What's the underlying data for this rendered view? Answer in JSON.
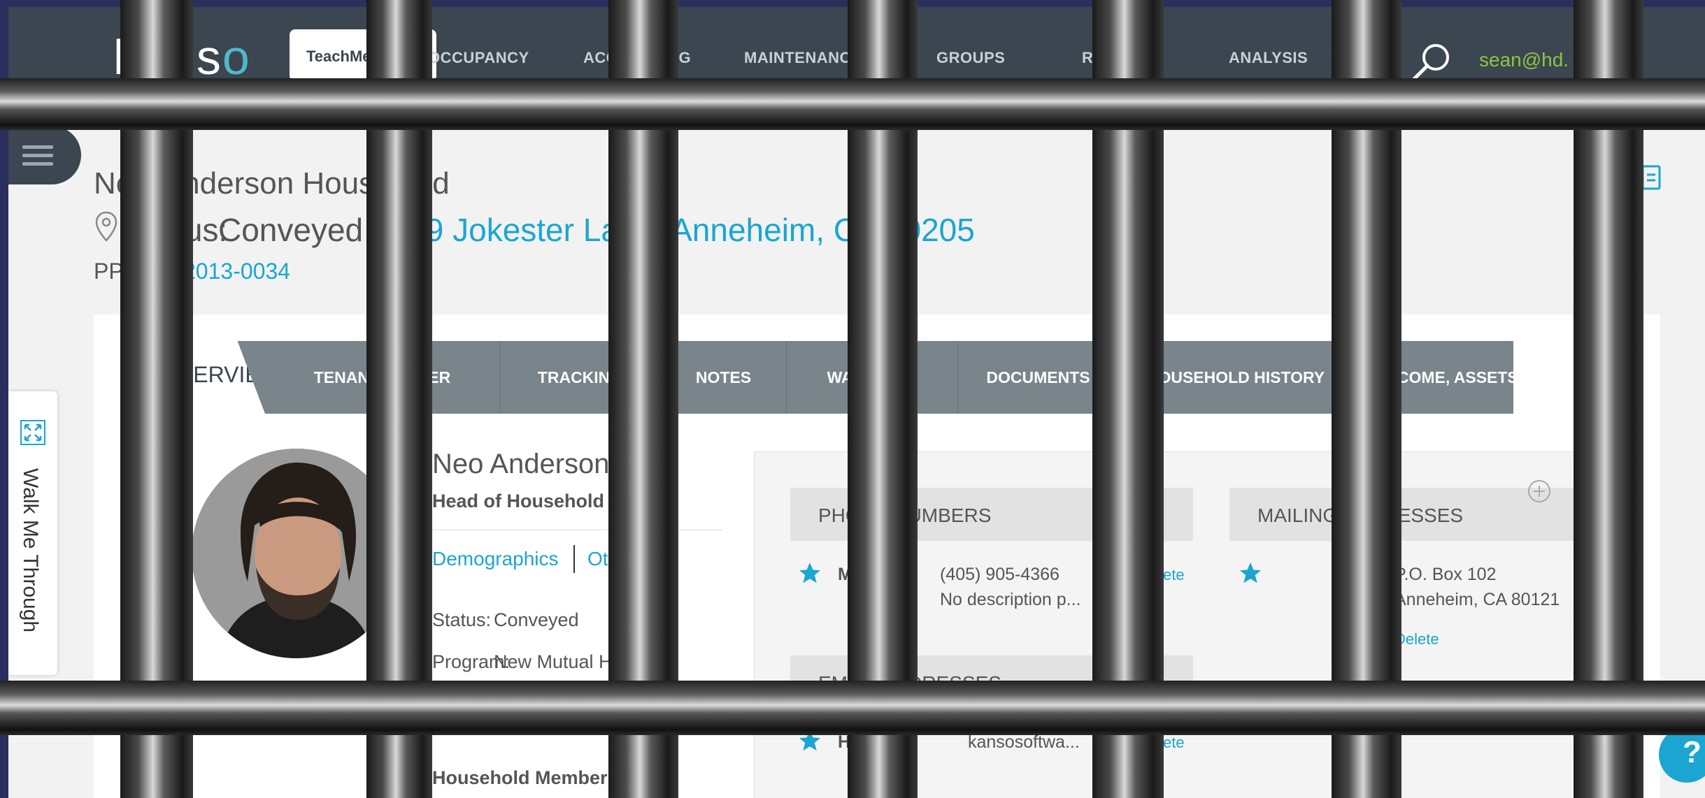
{
  "app": {
    "logo_text": "kanso",
    "company": "TeachMe",
    "user_email": "sean@hd."
  },
  "nav": {
    "items": [
      "OCCUPANCY",
      "ACCOUNTING",
      "MAINTENANCE",
      "GROUPS",
      "REPORTS",
      "ANALYSIS"
    ]
  },
  "household": {
    "title": "New Anderson Household",
    "status_label": "Status:",
    "status": "Conveyed",
    "address": "1239 Jokester Lane, Anneheim, CA 80205",
    "pp_label": "PP#",
    "pp_number": "2013-0034"
  },
  "tabs": {
    "overview": "OVERVIEW",
    "items": [
      "TENANT LEDGER",
      "TRACKING",
      "NOTES",
      "WAIT LISTS",
      "DOCUMENTS",
      "HOUSEHOLD HISTORY",
      "INCOME, ASSETS & EXPENSES"
    ]
  },
  "member": {
    "name": "Neo Anderson",
    "role": "Head of Household",
    "link_demographics": "Demographics",
    "link_other": "Other",
    "status_label": "Status:",
    "status_value": "Conveyed",
    "program_label": "Program:",
    "program_value": "New Mutual Help",
    "household_members": "Household Members"
  },
  "contacts": {
    "phone_header": "PHONE NUMBERS",
    "phone_type": "Mobile",
    "phone_number": "(405) 905-4366",
    "phone_desc": "No description p...",
    "phone_delete": "Delete",
    "email_header": "EMAIL ADDRESSES",
    "email_type": "Home",
    "email_value": "kansosoftwa...",
    "email_delete": "Delete",
    "mailing_header": "MAILING ADDRESSES",
    "mailing_line1": "P.O. Box 102",
    "mailing_line2": "Anneheim, CA 80121",
    "mailing_delete": "Delete"
  },
  "widgets": {
    "walk_me": "Walk Me Through",
    "help": "?"
  },
  "colors": {
    "nav_bg": "#3b4650",
    "accent": "#1aa6d0",
    "user_green": "#8dc63f",
    "tab_bar": "#7a848b"
  }
}
